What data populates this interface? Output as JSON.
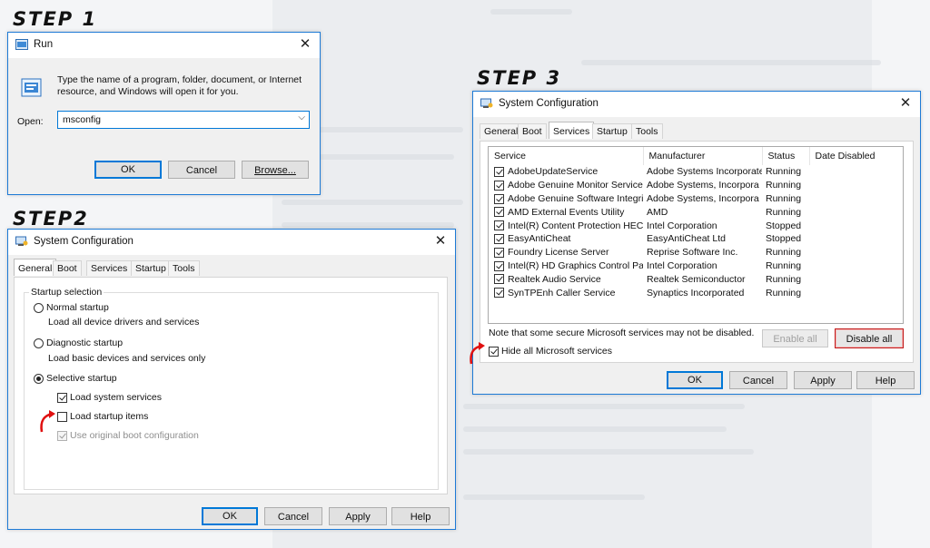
{
  "steps": {
    "step1": "STEP 1",
    "step2": "STEP2",
    "step3": "STEP 3"
  },
  "run_dialog": {
    "title": "Run",
    "description": "Type the name of a program, folder, document, or Internet resource, and Windows will open it for you.",
    "open_label": "Open:",
    "open_value": "msconfig",
    "ok": "OK",
    "cancel": "Cancel",
    "browse": "Browse..."
  },
  "general_dialog": {
    "title": "System Configuration",
    "tabs": [
      "General",
      "Boot",
      "Services",
      "Startup",
      "Tools"
    ],
    "group_title": "Startup selection",
    "normal": "Normal startup",
    "normal_desc": "Load all device drivers and services",
    "diagnostic": "Diagnostic startup",
    "diagnostic_desc": "Load basic devices and services only",
    "selective": "Selective startup",
    "load_system": "Load system services",
    "load_startup": "Load startup items",
    "use_original": "Use original boot configuration",
    "ok": "OK",
    "cancel": "Cancel",
    "apply": "Apply",
    "help": "Help"
  },
  "services_dialog": {
    "title": "System Configuration",
    "tabs": [
      "General",
      "Boot",
      "Services",
      "Startup",
      "Tools"
    ],
    "columns": [
      "Service",
      "Manufacturer",
      "Status",
      "Date Disabled"
    ],
    "rows": [
      {
        "service": "AdobeUpdateService",
        "manufacturer": "Adobe Systems Incorporated",
        "status": "Running"
      },
      {
        "service": "Adobe Genuine Monitor Service",
        "manufacturer": "Adobe Systems, Incorpora",
        "status": "Running"
      },
      {
        "service": "Adobe Genuine Software Integri...",
        "manufacturer": "Adobe Systems, Incorpora",
        "status": "Running"
      },
      {
        "service": "AMD External Events Utility",
        "manufacturer": "AMD",
        "status": "Running"
      },
      {
        "service": "Intel(R) Content Protection HEC...",
        "manufacturer": "Intel Corporation",
        "status": "Stopped"
      },
      {
        "service": "EasyAntiCheat",
        "manufacturer": "EasyAntiCheat Ltd",
        "status": "Stopped"
      },
      {
        "service": "Foundry License Server",
        "manufacturer": "Reprise Software Inc.",
        "status": "Running"
      },
      {
        "service": "Intel(R) HD Graphics Control Pa...",
        "manufacturer": "Intel Corporation",
        "status": "Running"
      },
      {
        "service": "Realtek Audio Service",
        "manufacturer": "Realtek Semiconductor",
        "status": "Running"
      },
      {
        "service": "SynTPEnh Caller Service",
        "manufacturer": "Synaptics Incorporated",
        "status": "Running"
      }
    ],
    "note": "Note that some secure Microsoft services may not be disabled.",
    "enable_all": "Enable all",
    "disable_all": "Disable all",
    "hide_ms": "Hide all Microsoft services",
    "ok": "OK",
    "cancel": "Cancel",
    "apply": "Apply",
    "help": "Help"
  },
  "colors": {
    "accent": "#1d7ad6",
    "highlight": "#c01b1b",
    "arrow": "#e01010"
  }
}
